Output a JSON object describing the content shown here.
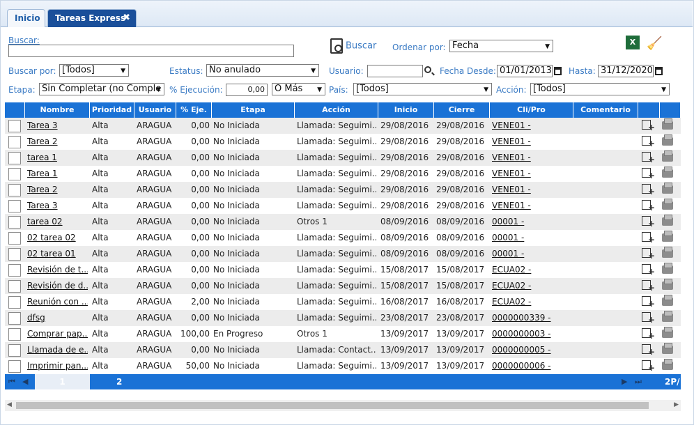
{
  "tabs": {
    "home": "Inicio",
    "active": "Tareas Express",
    "close": "✖"
  },
  "filters": {
    "buscar_label": "Buscar:",
    "buscar_value": "",
    "search_button": "Buscar",
    "ordenar_label": "Ordenar por:",
    "ordenar_value": "Fecha",
    "buscar_por_label": "Buscar por:",
    "buscar_por_value": "[Todos]",
    "estatus_label": "Estatus:",
    "estatus_value": "No anulado",
    "usuario_label": "Usuario:",
    "usuario_value": "",
    "fecha_desde_label": "Fecha Desde:",
    "fecha_desde_value": "01/01/2013",
    "hasta_label": "Hasta:",
    "hasta_value": "31/12/2020",
    "etapa_label": "Etapa:",
    "etapa_value": "Sin Completar (no Comple",
    "ejecucion_label": "% Ejecución:",
    "ejecucion_value": "0,00",
    "ejecucion_op": "O Más",
    "pais_label": "País:",
    "pais_value": "[Todos]",
    "accion_label": "Acción:",
    "accion_value": "[Todos]",
    "excel_icon": "X"
  },
  "columns": [
    "Nombre",
    "Prioridad",
    "Usuario",
    "% Eje.",
    "Etapa",
    "Acción",
    "Inicio",
    "Cierre",
    "Cli/Pro",
    "Comentario"
  ],
  "rows": [
    [
      "Tarea 3",
      "Alta",
      "ARAGUA",
      "0,00",
      "No Iniciada",
      "Llamada: Seguimi...",
      "29/08/2016",
      "29/08/2016",
      "VENE01 -",
      ""
    ],
    [
      "Tarea 2",
      "Alta",
      "ARAGUA",
      "0,00",
      "No Iniciada",
      "Llamada: Seguimi...",
      "29/08/2016",
      "29/08/2016",
      "VENE01 -",
      ""
    ],
    [
      "tarea 1",
      "Alta",
      "ARAGUA",
      "0,00",
      "No Iniciada",
      "Llamada: Seguimi...",
      "29/08/2016",
      "29/08/2016",
      "VENE01 -",
      ""
    ],
    [
      "Tarea 1",
      "Alta",
      "ARAGUA",
      "0,00",
      "No Iniciada",
      "Llamada: Seguimi...",
      "29/08/2016",
      "29/08/2016",
      "VENE01 -",
      ""
    ],
    [
      "Tarea 2",
      "Alta",
      "ARAGUA",
      "0,00",
      "No Iniciada",
      "Llamada: Seguimi...",
      "29/08/2016",
      "29/08/2016",
      "VENE01 -",
      ""
    ],
    [
      "Tarea 3",
      "Alta",
      "ARAGUA",
      "0,00",
      "No Iniciada",
      "Llamada: Seguimi...",
      "29/08/2016",
      "29/08/2016",
      "VENE01 -",
      ""
    ],
    [
      "tarea 02",
      "Alta",
      "ARAGUA",
      "0,00",
      "No Iniciada",
      "Otros 1",
      "08/09/2016",
      "08/09/2016",
      "00001 -",
      ""
    ],
    [
      "02 tarea 02",
      "Alta",
      "ARAGUA",
      "0,00",
      "No Iniciada",
      "Llamada: Seguimi...",
      "08/09/2016",
      "08/09/2016",
      "00001 -",
      ""
    ],
    [
      "02 tarea 01",
      "Alta",
      "ARAGUA",
      "0,00",
      "No Iniciada",
      "Llamada: Seguimi...",
      "08/09/2016",
      "08/09/2016",
      "00001 -",
      ""
    ],
    [
      "Revisión de t...",
      "Alta",
      "ARAGUA",
      "0,00",
      "No Iniciada",
      "Llamada: Seguimi...",
      "15/08/2017",
      "15/08/2017",
      "ECUA02 -",
      ""
    ],
    [
      "Revisión de d...",
      "Alta",
      "ARAGUA",
      "0,00",
      "No Iniciada",
      "Llamada: Seguimi...",
      "15/08/2017",
      "15/08/2017",
      "ECUA02 -",
      ""
    ],
    [
      "Reunión con ...",
      "Alta",
      "ARAGUA",
      "2,00",
      "No Iniciada",
      "Llamada: Seguimi...",
      "16/08/2017",
      "16/08/2017",
      "ECUA02 -",
      ""
    ],
    [
      "dfsg",
      "Alta",
      "ARAGUA",
      "0,00",
      "No Iniciada",
      "Llamada: Seguimi...",
      "23/08/2017",
      "23/08/2017",
      "0000000339 -",
      ""
    ],
    [
      "Comprar pap...",
      "Alta",
      "ARAGUA",
      "100,00",
      "En Progreso",
      "Otros 1",
      "13/09/2017",
      "13/09/2017",
      "0000000003 -",
      ""
    ],
    [
      "Llamada de e...",
      "Alta",
      "ARAGUA",
      "0,00",
      "No Iniciada",
      "Llamada: Contact...",
      "13/09/2017",
      "13/09/2017",
      "0000000005 -",
      ""
    ],
    [
      "Imprimir pan...",
      "Alta",
      "ARAGUA",
      "50,00",
      "No Iniciada",
      "Llamada: Seguimi...",
      "13/09/2017",
      "13/09/2017",
      "0000000006 -",
      ""
    ]
  ],
  "pager": {
    "page1": "1",
    "page2": "2",
    "info": "2P/"
  },
  "colors": {
    "header_blue": "#1a72d6",
    "tab_active": "#1a4f9a",
    "label_blue": "#3b7bc4"
  }
}
